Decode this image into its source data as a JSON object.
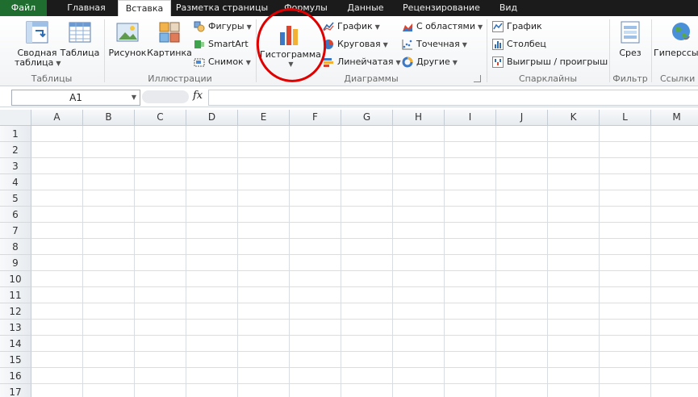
{
  "tabs": [
    {
      "label": "Файл"
    },
    {
      "label": "Главная"
    },
    {
      "label": "Вставка"
    },
    {
      "label": "Разметка страницы"
    },
    {
      "label": "Формулы"
    },
    {
      "label": "Данные"
    },
    {
      "label": "Рецензирование"
    },
    {
      "label": "Вид"
    }
  ],
  "ribbon": {
    "tables": {
      "label": "Таблицы",
      "pivot_line1": "Сводная",
      "pivot_line2": "таблица",
      "table": "Таблица"
    },
    "illustrations": {
      "label": "Иллюстрации",
      "picture": "Рисунок",
      "clipart": "Картинка",
      "shapes": "Фигуры",
      "smartart": "SmartArt",
      "screenshot": "Снимок"
    },
    "charts": {
      "label": "Диаграммы",
      "histogram": "Гистограмма",
      "line": "График",
      "pie": "Круговая",
      "bar": "Линейчатая",
      "area": "С областями",
      "scatter": "Точечная",
      "other": "Другие"
    },
    "sparklines": {
      "label": "Спарклайны",
      "line": "График",
      "column": "Столбец",
      "winloss": "Выигрыш / проигрыш"
    },
    "filter": {
      "label": "Фильтр",
      "slicer": "Срез"
    },
    "links": {
      "label": "Ссылки",
      "hyperlink": "Гиперссылка"
    }
  },
  "formula_bar": {
    "namebox": "A1",
    "fx": "fx",
    "value": ""
  },
  "columns": [
    "A",
    "B",
    "C",
    "D",
    "E",
    "F",
    "G",
    "H",
    "I",
    "J",
    "K",
    "L",
    "M"
  ],
  "rows": [
    "1",
    "2",
    "3",
    "4",
    "5",
    "6",
    "7",
    "8",
    "9",
    "10",
    "11",
    "12",
    "13",
    "14",
    "15",
    "16",
    "17"
  ],
  "colors": {
    "file_tab": "#1f6e2f",
    "annotation": "#e00000",
    "tabbar": "#1b1b1b"
  }
}
